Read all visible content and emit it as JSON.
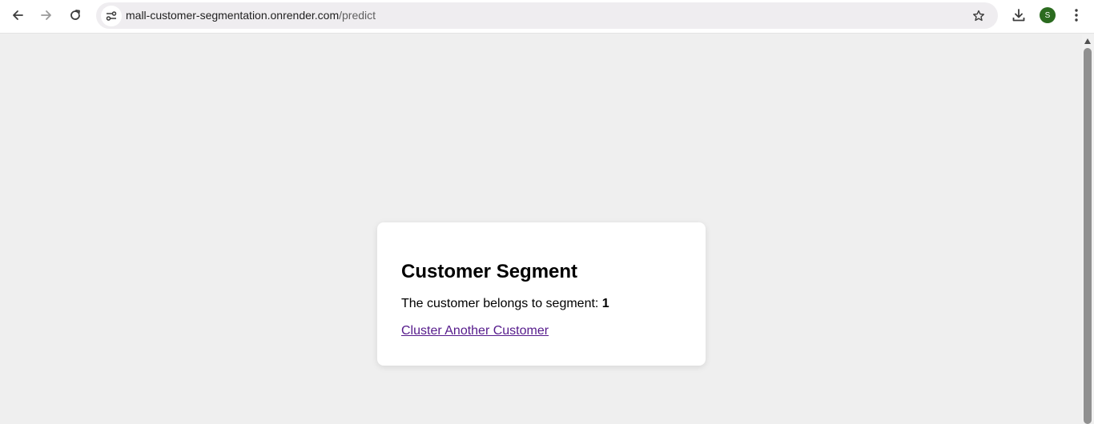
{
  "browser": {
    "url_host": "mall-customer-segmentation.onrender.com",
    "url_path": "/predict",
    "avatar_initial": "S",
    "avatar_color": "#2b6b1f"
  },
  "icons": {
    "back": "arrow-left-icon",
    "forward": "arrow-right-icon",
    "reload": "reload-icon",
    "site_info": "tune-icon",
    "bookmark": "star-icon",
    "download": "download-icon",
    "menu": "kebab-menu-icon"
  },
  "page": {
    "background": "#efefef",
    "card": {
      "title": "Customer Segment",
      "result_text": "The customer belongs to segment: ",
      "segment_value": "1",
      "link_label": "Cluster Another Customer",
      "link_color": "#551a8b"
    }
  }
}
